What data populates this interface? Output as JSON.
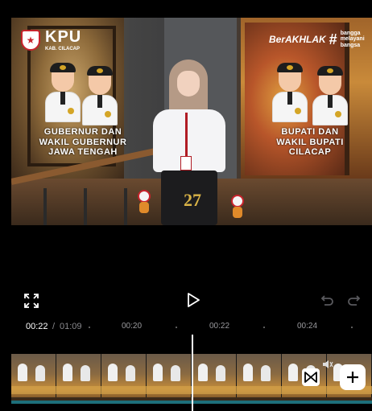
{
  "preview": {
    "kpu_title": "KPU",
    "kpu_subtitle": "KAB. CILACAP",
    "berakhlak_title": "BerAKHLAK",
    "bangga_text": "bangga melayani bangsa",
    "caption_left": "GUBERNUR DAN WAKIL GUBERNUR JAWA TENGAH",
    "caption_right": "BUPATI DAN WAKIL BUPATI CILACAP",
    "anniversary_number": "27"
  },
  "controls": {
    "fullscreen_icon": "fullscreen-icon",
    "play_icon": "play-icon",
    "undo_icon": "undo-icon",
    "redo_icon": "redo-icon"
  },
  "timebar": {
    "current": "00:22",
    "separator": "/",
    "total": "01:09",
    "ticks": [
      "00:20",
      "00:22",
      "00:24"
    ]
  },
  "timeline": {
    "transition_icon": "bowtie-icon",
    "volume_icon": "volume-icon",
    "add_icon": "plus-icon"
  },
  "colors": {
    "background": "#000000",
    "accent_teal": "#1d6f7a",
    "kpu_red": "#c8242c",
    "muted_text": "#8a8a8e"
  }
}
